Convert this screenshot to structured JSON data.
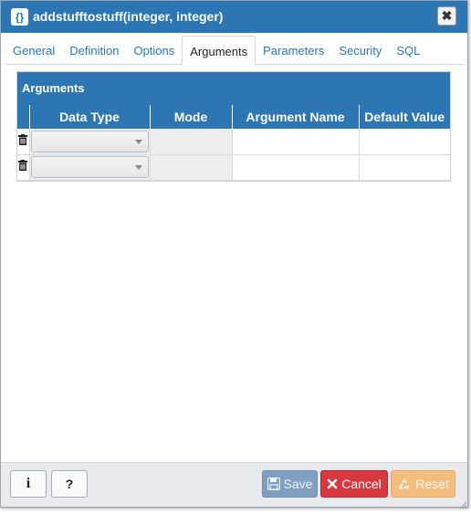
{
  "dialog": {
    "title": "addstufftostuff(integer, integer)"
  },
  "tabs": [
    {
      "label": "General"
    },
    {
      "label": "Definition"
    },
    {
      "label": "Options"
    },
    {
      "label": "Arguments"
    },
    {
      "label": "Parameters"
    },
    {
      "label": "Security"
    },
    {
      "label": "SQL"
    }
  ],
  "active_tab": "Arguments",
  "arguments": {
    "title": "Arguments",
    "columns": [
      "Data Type",
      "Mode",
      "Argument Name",
      "Default Value"
    ],
    "rows": [
      {
        "data_type": "",
        "mode": "",
        "argument_name": "",
        "default_value": ""
      },
      {
        "data_type": "",
        "mode": "",
        "argument_name": "",
        "default_value": ""
      }
    ]
  },
  "footer": {
    "info_label": "i",
    "help_label": "?",
    "save_label": "Save",
    "cancel_label": "Cancel",
    "reset_label": "Reset"
  },
  "colors": {
    "primary": "#2c76b4",
    "danger": "#d9363e",
    "save_disabled": "#7f9fc0",
    "reset_disabled": "#f3bd7e"
  },
  "icons": {
    "title": "function-icon",
    "close": "close-icon",
    "row_delete": "trash-icon",
    "save": "floppy-disk-icon",
    "cancel": "x-icon",
    "reset": "recycle-icon"
  }
}
